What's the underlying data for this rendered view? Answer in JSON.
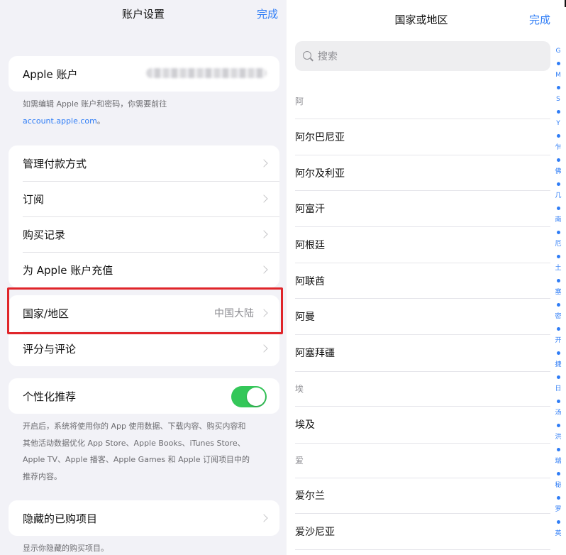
{
  "left": {
    "title": "账户设置",
    "done": "完成",
    "apple_account_label": "Apple 账户",
    "apple_note_line1": "如需编辑 Apple 账户和密码，你需要前往",
    "apple_note_link": "account.apple.com",
    "apple_note_tail": "。",
    "menu": [
      {
        "label": "管理付款方式"
      },
      {
        "label": "订阅"
      },
      {
        "label": "购买记录"
      },
      {
        "label": "为 Apple 账户充值"
      }
    ],
    "country": {
      "label": "国家/地区",
      "value": "中国大陆"
    },
    "ratings": {
      "label": "评分与评论"
    },
    "personalized": {
      "label": "个性化推荐",
      "enabled": true
    },
    "personalized_note": [
      "开启后，系统将使用你的 App 使用数据、下载内容、购买内容和",
      "其他活动数据优化 App Store、Apple Books、iTunes Store、",
      "Apple TV、Apple 播客、Apple Games 和 Apple 订阅项目中的",
      "推荐内容。"
    ],
    "hidden": {
      "label": "隐藏的已购项目"
    },
    "hidden_note": "显示你隐藏的购买项目。"
  },
  "right": {
    "title": "国家或地区",
    "done": "完成",
    "search_placeholder": "搜索",
    "sections": [
      {
        "header": "阿",
        "items": [
          "阿尔巴尼亚",
          "阿尔及利亚",
          "阿富汗",
          "阿根廷",
          "阿联酋",
          "阿曼",
          "阿塞拜疆"
        ]
      },
      {
        "header": "埃",
        "items": [
          "埃及"
        ]
      },
      {
        "header": "爱",
        "items": [
          "爱尔兰",
          "爱沙尼亚"
        ]
      }
    ],
    "index": [
      "G",
      "M",
      "S",
      "Y",
      "乍",
      "佛",
      "几",
      "南",
      "厄",
      "土",
      "塞",
      "密",
      "开",
      "捷",
      "日",
      "汤",
      "洪",
      "瑞",
      "秘",
      "罗",
      "英"
    ]
  },
  "colors": {
    "accent": "#2f7df6",
    "toggle_on": "#34c759",
    "highlight": "#e0252a"
  }
}
